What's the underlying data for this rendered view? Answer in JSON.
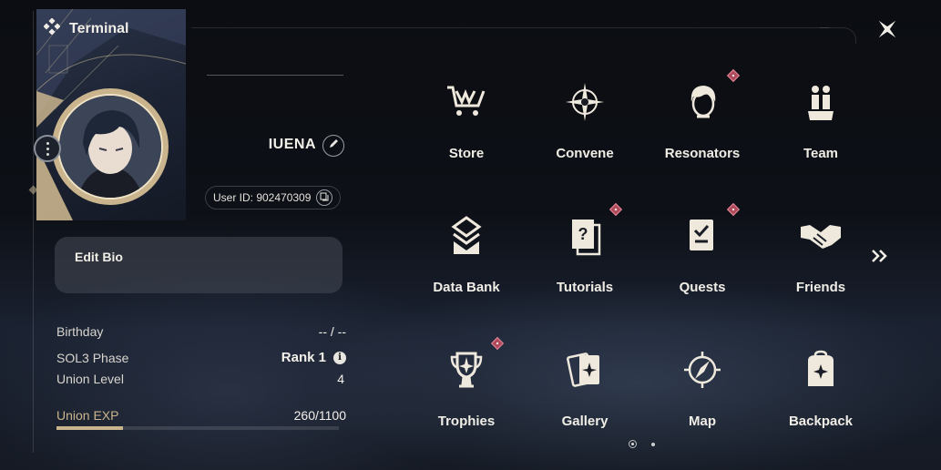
{
  "header": {
    "title": "Terminal",
    "terminal_icon": "diamond-cluster-icon",
    "close_icon": "close-star-icon"
  },
  "profile": {
    "username": "IUENA",
    "user_id": "User ID: 902470309",
    "edit_bio_label": "Edit Bio",
    "stats": {
      "birthday_label": "Birthday",
      "birthday_value": "-- / --",
      "phase_label": "SOL3 Phase",
      "phase_value": "Rank 1",
      "union_level_label": "Union Level",
      "union_level_value": "4",
      "union_exp_label": "Union EXP",
      "union_exp_value": "260/1100",
      "union_exp_fraction": 0.236
    }
  },
  "menu": {
    "items": [
      {
        "label": "Store",
        "icon": "cart-icon",
        "badge": false
      },
      {
        "label": "Convene",
        "icon": "compass-star-icon",
        "badge": false
      },
      {
        "label": "Resonators",
        "icon": "character-head-icon",
        "badge": true
      },
      {
        "label": "Team",
        "icon": "team-figures-icon",
        "badge": false
      },
      {
        "label": "Data Bank",
        "icon": "data-bank-icon",
        "badge": false
      },
      {
        "label": "Tutorials",
        "icon": "question-card-icon",
        "badge": true
      },
      {
        "label": "Quests",
        "icon": "checklist-icon",
        "badge": true
      },
      {
        "label": "Friends",
        "icon": "handshake-icon",
        "badge": false
      },
      {
        "label": "Trophies",
        "icon": "trophy-icon",
        "badge": true
      },
      {
        "label": "Gallery",
        "icon": "cards-icon",
        "badge": false
      },
      {
        "label": "Map",
        "icon": "map-compass-icon",
        "badge": false
      },
      {
        "label": "Backpack",
        "icon": "backpack-icon",
        "badge": false
      }
    ],
    "next_page_icon": "double-chevron-right-icon",
    "page_current": 1,
    "page_total": 2
  },
  "colors": {
    "accent": "#c9b48d",
    "badge": "#b04a5a",
    "text": "#f0ede6"
  }
}
